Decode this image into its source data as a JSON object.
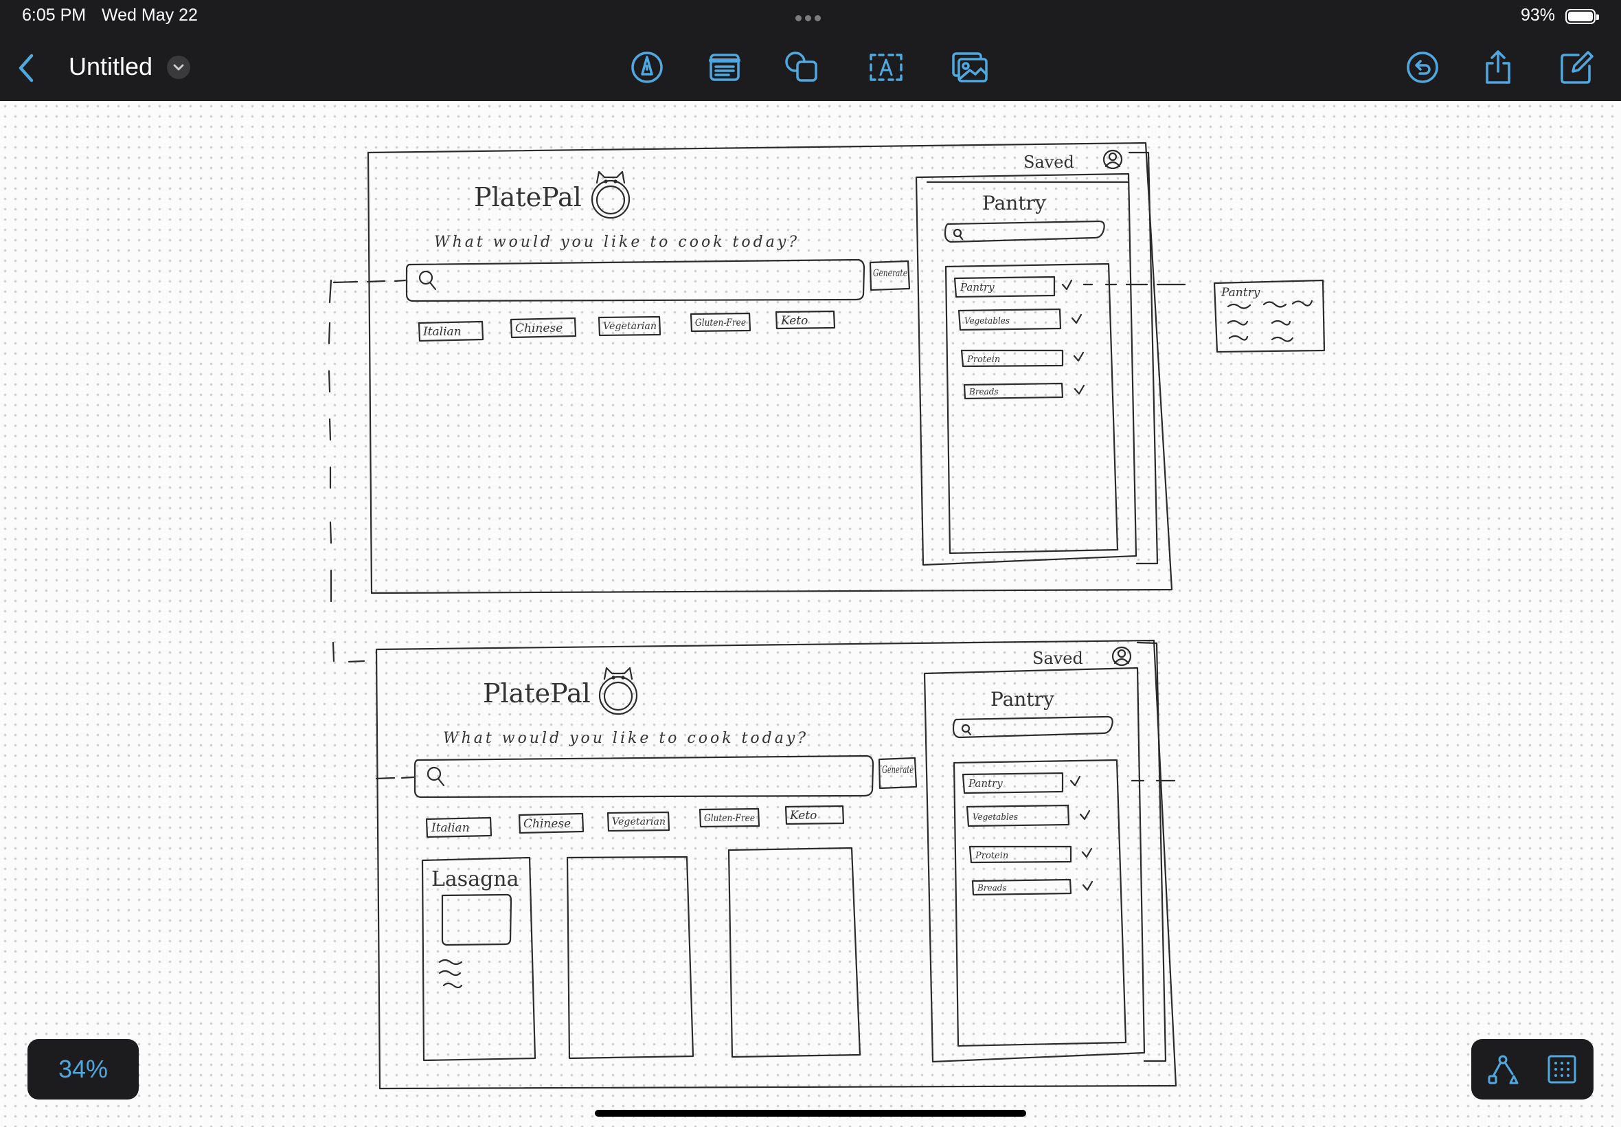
{
  "status_bar": {
    "time": "6:05 PM",
    "date": "Wed May 22",
    "battery": "93%",
    "battery_level": 0.93
  },
  "toolbar": {
    "title": "Untitled"
  },
  "icons": {
    "back": "chevron-left-icon",
    "title_menu": "chevron-down-icon",
    "pen": "pen-icon",
    "notes": "note-icon",
    "shapes": "shapes-icon",
    "textbox": "text-box-icon",
    "media": "image-icon",
    "undo": "undo-icon",
    "share": "share-icon",
    "compose": "compose-icon",
    "connect": "connector-icon",
    "grid": "grid-icon"
  },
  "colors": {
    "accent": "#4fa9e0",
    "chrome": "#1c1c1e"
  },
  "zoom": "34%",
  "sketch_top": {
    "header_link": "Saved",
    "app_name": "PlatePal",
    "prompt": "What would you like to cook today?",
    "generate_button": "Generate",
    "chips": [
      "Italian",
      "Chinese",
      "Vegetarian",
      "Gluten-Free",
      "Keto"
    ],
    "pantry_title": "Pantry",
    "pantry_items": [
      "Pantry",
      "Vegetables",
      "Protein",
      "Breads"
    ],
    "popup_title": "Pantry"
  },
  "sketch_bottom": {
    "header_link": "Saved",
    "app_name": "PlatePal",
    "prompt": "What would you like to cook today?",
    "generate_button": "Generate",
    "chips": [
      "Italian",
      "Chinese",
      "Vegetarian",
      "Gluten-Free",
      "Keto"
    ],
    "pantry_title": "Pantry",
    "pantry_items": [
      "Pantry",
      "Vegetables",
      "Protein",
      "Breads"
    ],
    "recipe_card_title": "Lasagna"
  }
}
